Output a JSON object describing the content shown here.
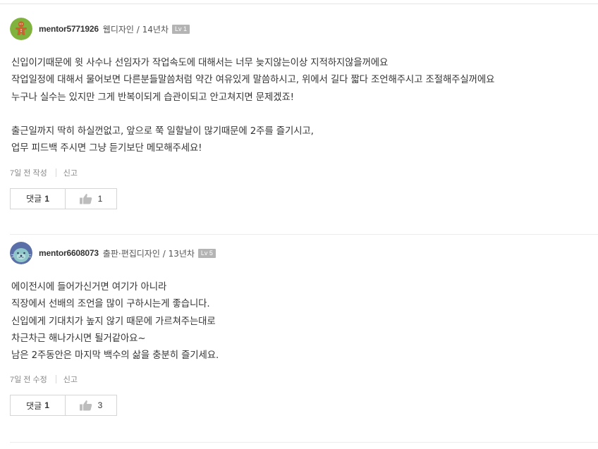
{
  "colors": {
    "level_badge": "#b4b4b4",
    "border": "#d5d5d5",
    "text": "#333333",
    "muted": "#888888"
  },
  "answers": [
    {
      "username": "mentor5771926",
      "meta": "웹디자인 / 14년차",
      "level": "Lv 1",
      "avatar_icon": "gingerbread-avatar-icon",
      "lines": [
        "신입이기때문에 윗 사수나 선임자가 작업속도에 대해서는 너무 늦지않는이상 지적하지않을꺼에요",
        "작업일정에 대해서 물어보면 다른분들말씀처럼 약간 여유있게 말씀하시고, 위에서 길다 짧다 조언해주시고 조절해주실꺼에요",
        "누구나 실수는 있지만 그게 반복이되게 습관이되고 안고쳐지면 문제겠죠!",
        "",
        "출근일까지 딱히 하실껀없고, 앞으로 쭉 일할날이 많기때문에 2주를 즐기시고,",
        "업무 피드백 주시면 그냥 듣기보단 메모해주세요!"
      ],
      "time": "7일 전 작성",
      "report": "신고",
      "comment_label": "댓글",
      "comment_count": "1",
      "like_count": "1"
    },
    {
      "username": "mentor6608073",
      "meta": "출판·편집디자인 / 13년차",
      "level": "Lv 5",
      "avatar_icon": "seal-avatar-icon",
      "lines": [
        "에이전시에 들어가신거면 여기가 아니라",
        "직장에서 선배의 조언을 많이 구하시는게 좋습니다.",
        "신입에게 기대치가 높지 않기 때문에 가르쳐주는대로",
        "차근차근 해나가시면 될거같아요~",
        "남은 2주동안은 마지막 백수의 삶을 충분히 즐기세요."
      ],
      "time": "7일 전 수정",
      "report": "신고",
      "comment_label": "댓글",
      "comment_count": "1",
      "like_count": "3"
    }
  ]
}
